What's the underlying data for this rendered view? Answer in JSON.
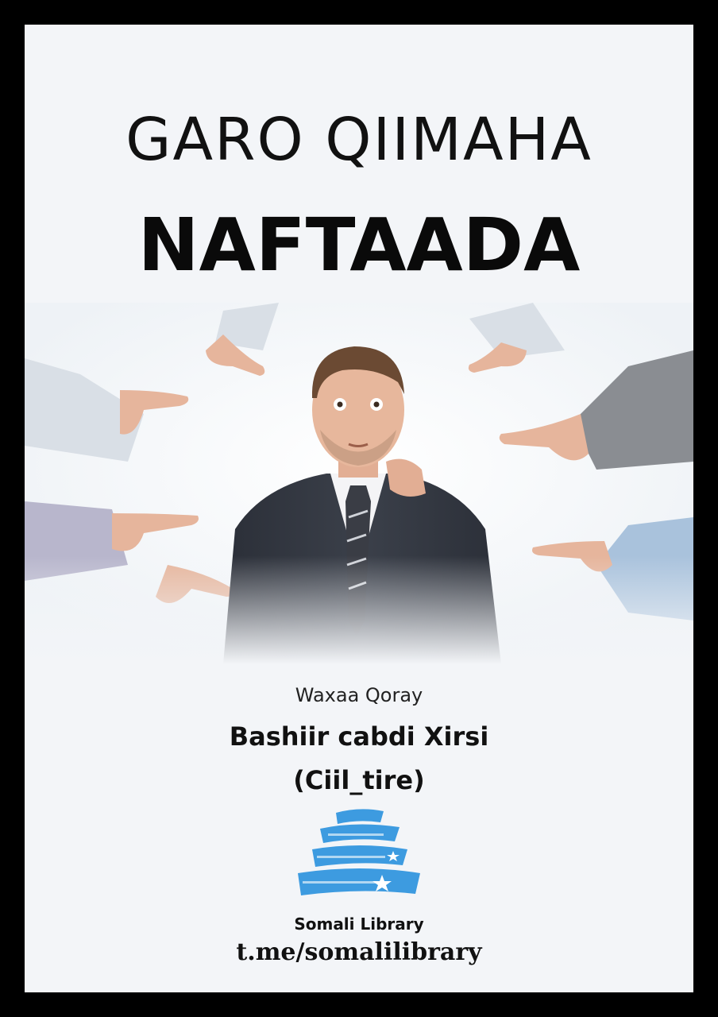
{
  "cover": {
    "title_line1": "GARO QIIMAHA",
    "title_line2": "NAFTAADA",
    "author_label": "Waxaa Qoray",
    "author_name": "Bashiir cabdi Xirsi",
    "author_alias": "(Ciil_tire)"
  },
  "publisher": {
    "name": "Somali Library",
    "link": "t.me/somalilibrary",
    "logo_icon": "books-stack-star-icon",
    "logo_color": "#3d9be0"
  },
  "colors": {
    "frame": "#000000",
    "background": "#f3f5f8",
    "text": "#111111"
  }
}
